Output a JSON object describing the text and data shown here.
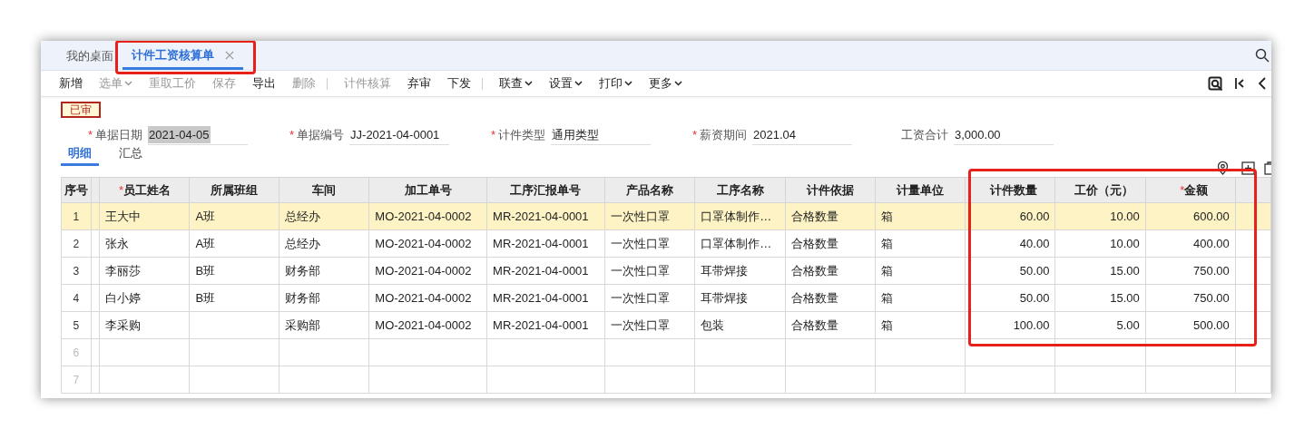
{
  "tabs": [
    {
      "label": "我的桌面",
      "selected": false,
      "closable": false,
      "highlighted": false
    },
    {
      "label": "计件工资核算单",
      "selected": true,
      "closable": true,
      "highlighted": true
    }
  ],
  "toolbar": [
    {
      "label": "新增",
      "disabled": false,
      "dropdown": false,
      "separator_after": false
    },
    {
      "label": "选单",
      "disabled": true,
      "dropdown": true,
      "separator_after": false
    },
    {
      "label": "重取工价",
      "disabled": true,
      "dropdown": false,
      "separator_after": false
    },
    {
      "label": "保存",
      "disabled": true,
      "dropdown": false,
      "separator_after": false
    },
    {
      "label": "导出",
      "disabled": false,
      "dropdown": false,
      "separator_after": false
    },
    {
      "label": "删除",
      "disabled": true,
      "dropdown": false,
      "separator_after": true
    },
    {
      "label": "计件核算",
      "disabled": true,
      "dropdown": false,
      "separator_after": false
    },
    {
      "label": "弃审",
      "disabled": false,
      "dropdown": false,
      "separator_after": false
    },
    {
      "label": "下发",
      "disabled": false,
      "dropdown": false,
      "separator_after": true
    },
    {
      "label": "联查",
      "disabled": false,
      "dropdown": true,
      "separator_after": false
    },
    {
      "label": "设置",
      "disabled": false,
      "dropdown": true,
      "separator_after": false
    },
    {
      "label": "打印",
      "disabled": false,
      "dropdown": true,
      "separator_after": false
    },
    {
      "label": "更多",
      "disabled": false,
      "dropdown": true,
      "separator_after": false
    }
  ],
  "status_badge": "已审",
  "fields": [
    {
      "label": "单据日期",
      "value": "2021-04-05",
      "required_mark": "*",
      "selected": true
    },
    {
      "label": "单据编号",
      "value": "JJ-2021-04-0001",
      "required_mark": "*",
      "selected": false
    },
    {
      "label": "计件类型",
      "value": "通用类型",
      "required_mark": "*",
      "selected": false
    },
    {
      "label": "薪资期间",
      "value": "2021.04",
      "required_mark": "*",
      "selected": false
    },
    {
      "label": "工资合计",
      "value": "3,000.00",
      "selected": false
    }
  ],
  "sub_tabs": [
    {
      "label": "明细",
      "selected": true
    },
    {
      "label": "汇总",
      "selected": false
    }
  ],
  "table": {
    "column_groups": [
      {
        "highlighted": false,
        "columns": [
          {
            "label": "员工姓名",
            "required_mark": "*",
            "kind": "text"
          },
          {
            "label": "所属班组",
            "kind": "text"
          },
          {
            "label": "车间",
            "kind": "text"
          },
          {
            "label": "加工单号",
            "kind": "text"
          },
          {
            "label": "工序汇报单号",
            "kind": "text"
          },
          {
            "label": "产品名称",
            "kind": "text"
          },
          {
            "label": "工序名称",
            "kind": "text"
          },
          {
            "label": "计件依据",
            "kind": "text"
          },
          {
            "label": "计量单位",
            "kind": "text"
          }
        ]
      },
      {
        "highlighted": true,
        "columns": [
          {
            "label": "计件数量",
            "kind": "number"
          },
          {
            "label": "工价（元）",
            "kind": "number"
          },
          {
            "label": "金额",
            "required_mark": "*",
            "kind": "number"
          }
        ]
      }
    ],
    "number_header": "序号",
    "rows": [
      {
        "no": "1",
        "selected": true,
        "filled": true,
        "cells": [
          "王大中",
          "A班",
          "总经办",
          "MO-2021-04-0002",
          "MR-2021-04-0001",
          "一次性口罩",
          "口罩体制作…",
          "合格数量",
          "箱",
          "60.00",
          "10.00",
          "600.00"
        ]
      },
      {
        "no": "2",
        "selected": false,
        "filled": true,
        "cells": [
          "张永",
          "A班",
          "总经办",
          "MO-2021-04-0002",
          "MR-2021-04-0001",
          "一次性口罩",
          "口罩体制作…",
          "合格数量",
          "箱",
          "40.00",
          "10.00",
          "400.00"
        ]
      },
      {
        "no": "3",
        "selected": false,
        "filled": true,
        "cells": [
          "李丽莎",
          "B班",
          "财务部",
          "MO-2021-04-0002",
          "MR-2021-04-0001",
          "一次性口罩",
          "耳带焊接",
          "合格数量",
          "箱",
          "50.00",
          "15.00",
          "750.00"
        ]
      },
      {
        "no": "4",
        "selected": false,
        "filled": true,
        "cells": [
          "白小婷",
          "B班",
          "财务部",
          "MO-2021-04-0002",
          "MR-2021-04-0001",
          "一次性口罩",
          "耳带焊接",
          "合格数量",
          "箱",
          "50.00",
          "15.00",
          "750.00"
        ]
      },
      {
        "no": "5",
        "selected": false,
        "filled": true,
        "cells": [
          "李采购",
          null,
          "采购部",
          "MO-2021-04-0002",
          "MR-2021-04-0001",
          "一次性口罩",
          "包装",
          "合格数量",
          "箱",
          "100.00",
          "5.00",
          "500.00"
        ]
      },
      {
        "no": "6",
        "selected": false,
        "filled": false,
        "cells": []
      },
      {
        "no": "7",
        "selected": false,
        "filled": false,
        "cells": []
      }
    ]
  }
}
